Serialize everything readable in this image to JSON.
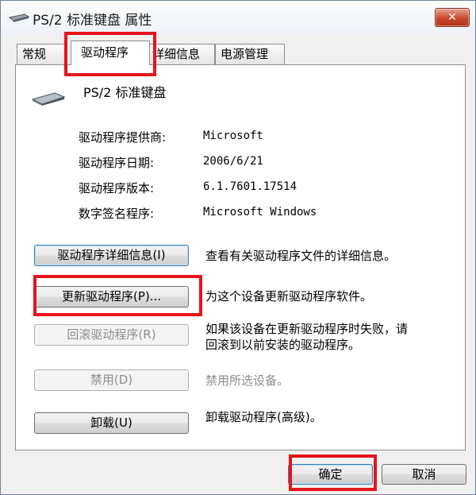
{
  "window": {
    "title": "PS/2 标准键盘 属性",
    "close_label": "✕",
    "icons": {
      "title": "keyboard-icon",
      "device": "keyboard-device-icon"
    }
  },
  "tabs": [
    {
      "label": "常规"
    },
    {
      "label": "驱动程序"
    },
    {
      "label": "详细信息"
    },
    {
      "label": "电源管理"
    }
  ],
  "device": {
    "name": "PS/2 标准键盘"
  },
  "info": [
    {
      "label": "驱动程序提供商:",
      "value": "Microsoft"
    },
    {
      "label": "驱动程序日期:",
      "value": "2006/6/21"
    },
    {
      "label": "驱动程序版本:",
      "value": "6.1.7601.17514"
    },
    {
      "label": "数字签名程序:",
      "value": "Microsoft Windows"
    }
  ],
  "actions": [
    {
      "label": "驱动程序详细信息(I)",
      "desc": "查看有关驱动程序文件的详细信息。",
      "enabled": true
    },
    {
      "label": "更新驱动程序(P)...",
      "desc": "为这个设备更新驱动程序软件。",
      "enabled": true
    },
    {
      "label": "回滚驱动程序(R)",
      "desc_line1": "如果该设备在更新驱动程序时失败，请",
      "desc_line2": "回滚到以前安装的驱动程序。",
      "enabled": false
    },
    {
      "label": "禁用(D)",
      "desc": "禁用所选设备。",
      "enabled": false
    },
    {
      "label": "卸载(U)",
      "desc": "卸载驱动程序(高级)。",
      "enabled": true
    }
  ],
  "footer": {
    "ok_label": "确定",
    "cancel_label": "取消"
  },
  "colors": {
    "highlight": "#e5141b",
    "close_button": "#c7462b"
  }
}
